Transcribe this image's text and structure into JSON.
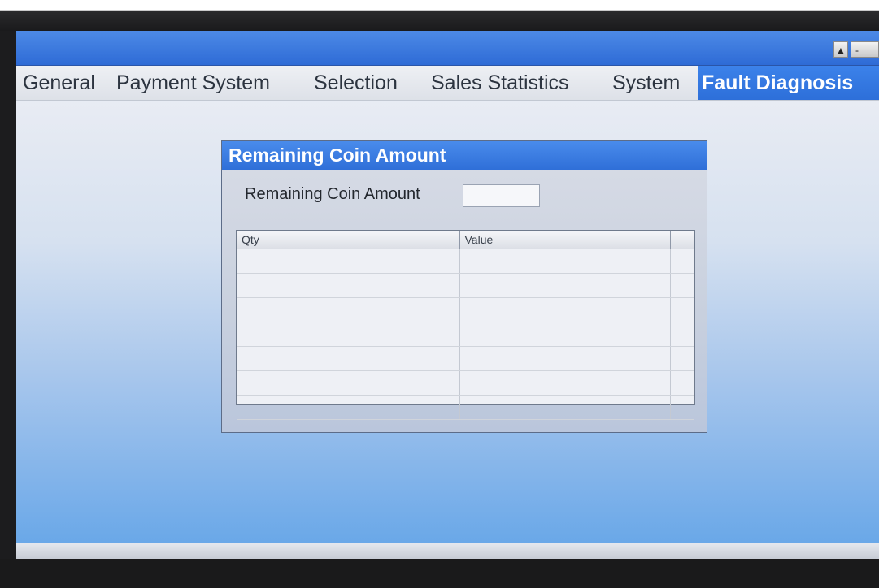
{
  "window": {
    "scroll_up_icon": "triangle-up-icon",
    "minimize_label": "-"
  },
  "tabs": [
    {
      "label": "General",
      "active": false
    },
    {
      "label": "Payment System",
      "active": false
    },
    {
      "label": "Selection",
      "active": false
    },
    {
      "label": "Sales Statistics",
      "active": false
    },
    {
      "label": "System",
      "active": false
    },
    {
      "label": "Fault Diagnosis",
      "active": true
    }
  ],
  "dialog": {
    "title": "Remaining Coin Amount",
    "field_label": "Remaining Coin Amount",
    "field_value": "",
    "table": {
      "columns": [
        "Qty",
        "Value",
        ""
      ],
      "rows": [
        [
          "",
          "",
          ""
        ],
        [
          "",
          "",
          ""
        ],
        [
          "",
          "",
          ""
        ],
        [
          "",
          "",
          ""
        ],
        [
          "",
          "",
          ""
        ],
        [
          "",
          "",
          ""
        ],
        [
          "",
          "",
          ""
        ]
      ]
    }
  },
  "colors": {
    "title_bar": "#2e6bd6",
    "active_tab": "#2d6fd9",
    "dialog_header": "#2f6fd8"
  }
}
